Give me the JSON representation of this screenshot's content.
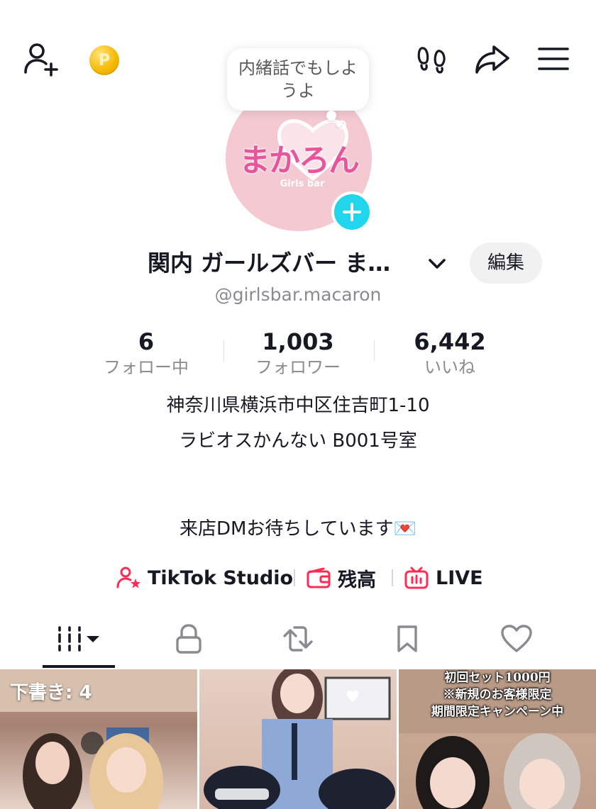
{
  "header": {
    "add_friend_icon": "person-plus-icon",
    "coin_icon": "coin-icon",
    "coin_letter": "P",
    "footprints_icon": "footprints-icon",
    "share_icon": "share-arrow-icon",
    "menu_icon": "hamburger-menu-icon"
  },
  "profile": {
    "status_bubble": "内緒話でもしようよ",
    "avatar_logo_text": "まかろん",
    "avatar_logo_sub": "Girls bar",
    "display_name": "関内 ガールズバー ま…",
    "handle": "@girlsbar.macaron",
    "edit_label": "編集"
  },
  "stats": [
    {
      "value": "6",
      "label": "フォロー中"
    },
    {
      "value": "1,003",
      "label": "フォロワー"
    },
    {
      "value": "6,442",
      "label": "いいね"
    }
  ],
  "bio": {
    "line1": "神奈川県横浜市中区住吉町1-10",
    "line2": "ラビオスかんない B001号室",
    "line3": "来店DMお待ちしています💌"
  },
  "links": {
    "studio": "TikTok Studio",
    "balance": "残高",
    "live": "LIVE"
  },
  "tabs": [
    "videos-tab",
    "private-tab",
    "reposts-tab",
    "favorites-tab",
    "liked-tab"
  ],
  "grid": {
    "draft_label": "下書き: 4",
    "promo_line1": "初回セット1000円",
    "promo_line2": "※新規のお客様限定",
    "promo_line3": "期間限定キャンペーン中"
  },
  "colors": {
    "accent_cyan": "#20d5ec",
    "brand_pink": "#fe2c55",
    "avatar_bg": "#f4c9d2",
    "logo_pink": "#e8559a"
  }
}
